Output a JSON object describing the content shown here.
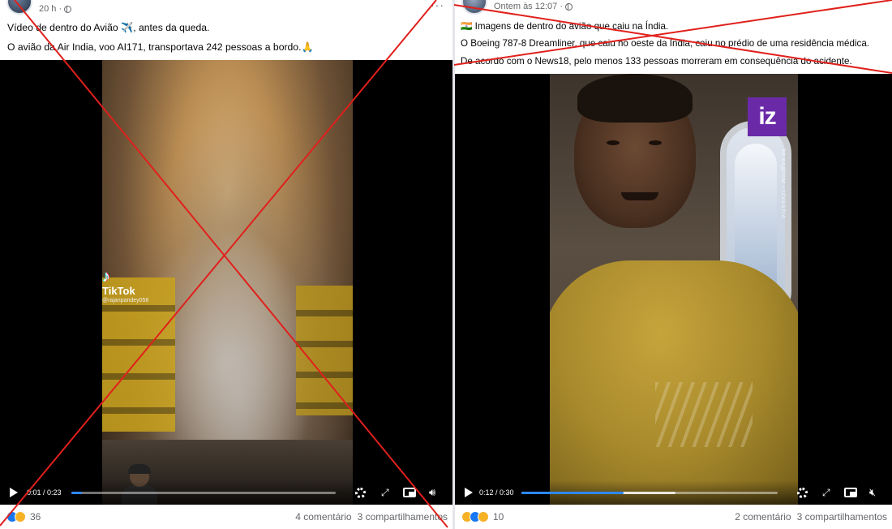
{
  "left_post": {
    "time_label": "20 h ·",
    "text_line1": "Vídeo de dentro do Avião ✈️, antes da queda.",
    "text_line2": "O avião da Air India, voo AI171, transportava 242 pessoas a bordo.🙏",
    "video": {
      "tiktok_brand": "TikTok",
      "tiktok_user": "@rajanpandey058",
      "time": "0:01 / 0:23",
      "progress": 0.04
    },
    "reaction_count": "36",
    "comments": "4 comentário",
    "shares": "3 compartilhamentos"
  },
  "right_post": {
    "time_label": "Ontem às 12:07 ·",
    "text_line1": "🇮🇳 Imagens de dentro do avião que caiu na Índia.",
    "text_line2": "O Boeing 787-8 Dreamliner, que caiu no oeste da Índia, caiu no prédio de uma residência médica.",
    "text_line3": "De acordo com o News18, pelo menos 133 pessoas morreram em consequência do acidente.",
    "video": {
      "logo": "iz",
      "watermark": "ЗА КАДРОМ • IZVESTIA",
      "time": "0:12 / 0:30",
      "progress": 0.4,
      "buffered": 0.6
    },
    "reaction_count": "10",
    "comments": "2 comentário",
    "shares": "3 compartilhamentos"
  },
  "overlay": {
    "cross_color": "#e0201c"
  }
}
